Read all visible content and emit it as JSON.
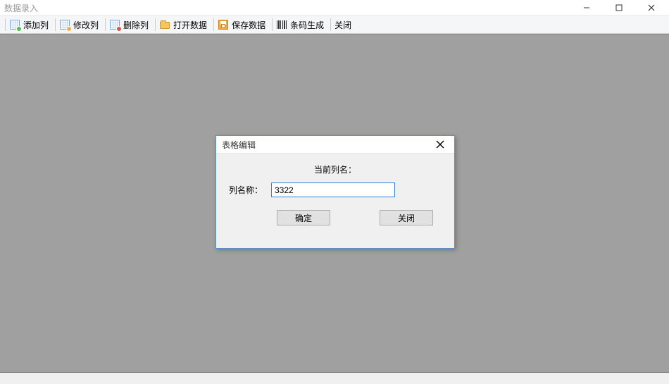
{
  "window": {
    "title": "数据录入"
  },
  "toolbar": {
    "add_column": "添加列",
    "edit_column": "修改列",
    "delete_column": "删除列",
    "open_data": "打开数据",
    "save_data": "保存数据",
    "barcode_gen": "条码生成",
    "close": "关闭"
  },
  "dialog": {
    "title": "表格编辑",
    "heading": "当前列名：",
    "field_label": "列名称：",
    "field_value": "3322",
    "ok": "确定",
    "close": "关闭"
  }
}
